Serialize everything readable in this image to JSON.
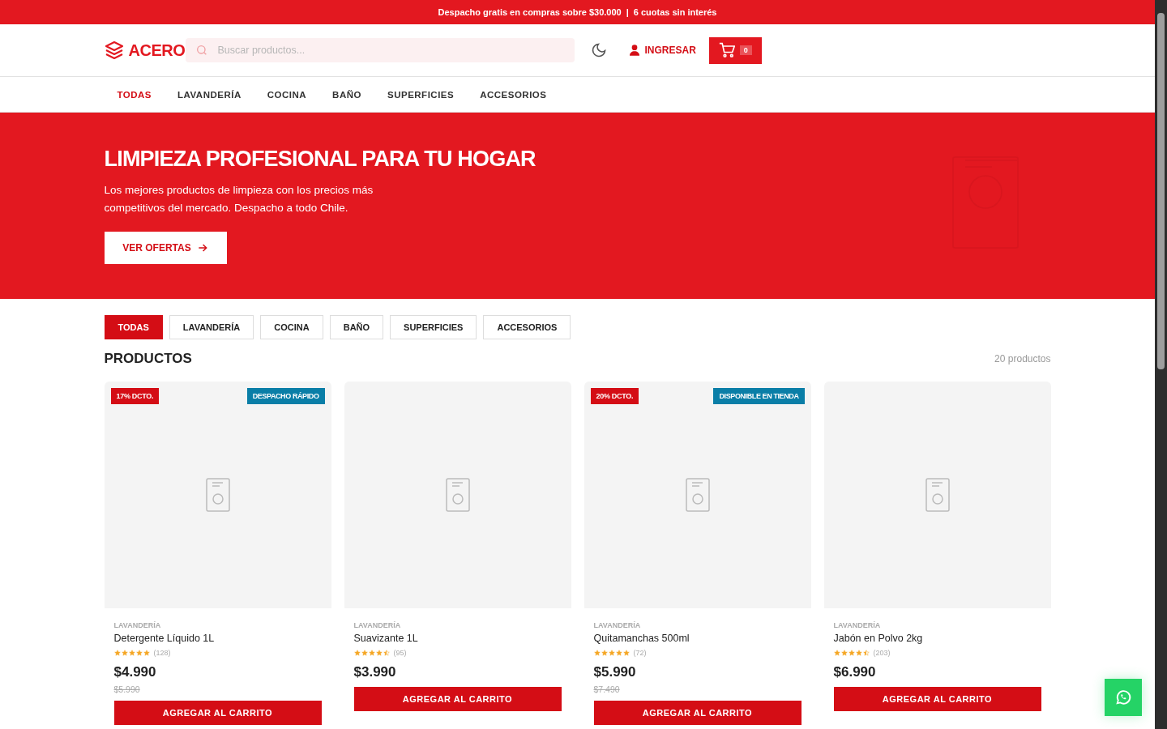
{
  "announcement": {
    "shipping": "Despacho gratis en compras sobre $30.000",
    "separator": "|",
    "installments": "6 cuotas sin interés"
  },
  "header": {
    "logo": "ACERO",
    "search": {
      "placeholder": "Buscar productos..."
    },
    "login": "INGRESAR",
    "cart_count": "0"
  },
  "nav": [
    {
      "label": "TODAS",
      "selected": true
    },
    {
      "label": "LAVANDERÍA",
      "selected": false
    },
    {
      "label": "COCINA",
      "selected": false
    },
    {
      "label": "BAÑO",
      "selected": false
    },
    {
      "label": "SUPERFICIES",
      "selected": false
    },
    {
      "label": "ACCESORIOS",
      "selected": false
    }
  ],
  "hero": {
    "title": "LIMPIEZA PROFESIONAL PARA TU HOGAR",
    "text": "Los mejores productos de limpieza con los precios más competitivos del mercado. Despacho a todo Chile.",
    "button": "VER OFERTAS"
  },
  "filters": [
    {
      "label": "TODAS",
      "selected": true
    },
    {
      "label": "LAVANDERÍA",
      "selected": false
    },
    {
      "label": "COCINA",
      "selected": false
    },
    {
      "label": "BAÑO",
      "selected": false
    },
    {
      "label": "SUPERFICIES",
      "selected": false
    },
    {
      "label": "ACCESORIOS",
      "selected": false
    }
  ],
  "products_title": "PRODUCTOS",
  "products_count": "20 productos",
  "products": [
    {
      "discount": "17% DCTO.",
      "tag": "DESPACHO RÁPIDO",
      "category": "LAVANDERÍA",
      "name": "Detergente Líquido 1L",
      "stars": 5,
      "reviews": "(128)",
      "price": "$4.990",
      "old_price": "$5.990",
      "button": "AGREGAR AL CARRITO"
    },
    {
      "category": "LAVANDERÍA",
      "name": "Suavizante 1L",
      "stars": 4.5,
      "reviews": "(95)",
      "price": "$3.990",
      "button": "AGREGAR AL CARRITO"
    },
    {
      "discount": "20% DCTO.",
      "tag": "DISPONIBLE EN TIENDA",
      "category": "LAVANDERÍA",
      "name": "Quitamanchas 500ml",
      "stars": 5,
      "reviews": "(72)",
      "price": "$5.990",
      "old_price": "$7.490",
      "button": "AGREGAR AL CARRITO"
    },
    {
      "category": "LAVANDERÍA",
      "name": "Jabón en Polvo 2kg",
      "stars": 4.5,
      "reviews": "(203)",
      "price": "$6.990",
      "button": "AGREGAR AL CARRITO"
    }
  ]
}
